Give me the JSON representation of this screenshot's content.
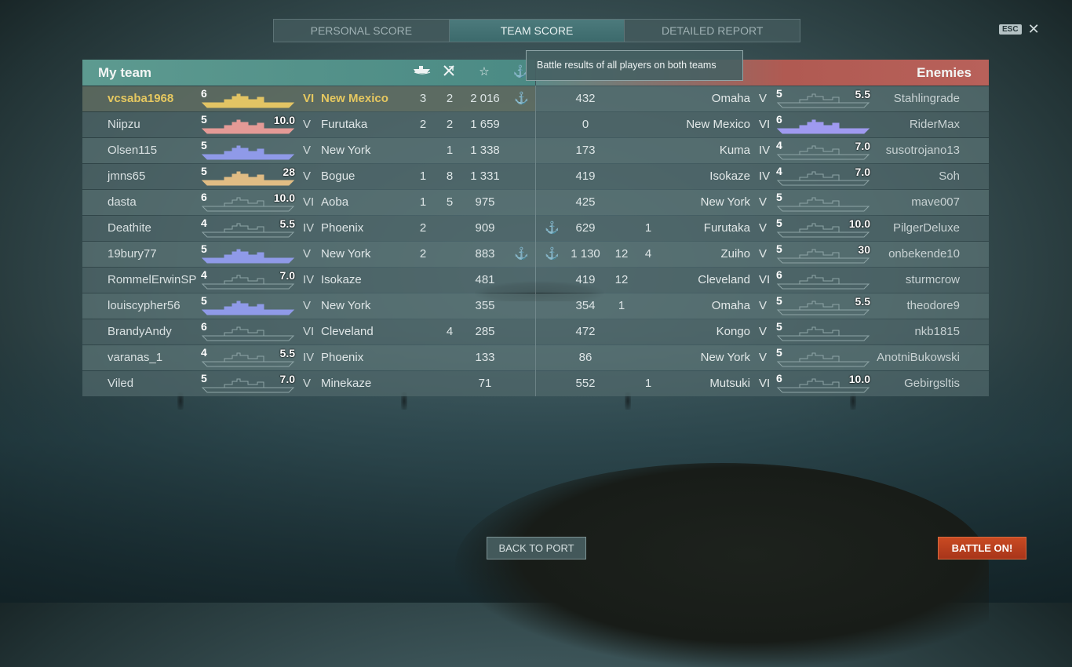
{
  "tabs": [
    {
      "label": "PERSONAL SCORE",
      "active": false
    },
    {
      "label": "TEAM SCORE",
      "active": true
    },
    {
      "label": "DETAILED REPORT",
      "active": false
    }
  ],
  "esc": {
    "key": "ESC",
    "close": "✕"
  },
  "header": {
    "my_team": "My team",
    "enemies": "Enemies",
    "icons": [
      "ship-sunk-icon",
      "planes-destroyed-icon",
      "star-icon",
      "anchor-icon"
    ]
  },
  "tooltip": "Battle results of all players on both teams",
  "colors": {
    "own_player": "#e6c860",
    "battle_button": "#c94a22"
  },
  "my_team": [
    {
      "name": "vcsaba1968",
      "level": "6",
      "power": "",
      "ship_color": "#e2c464",
      "tier": "VI",
      "ship": "New Mexico",
      "k1": "3",
      "k2": "2",
      "score": "2 016",
      "anchor": "⚓",
      "me": true
    },
    {
      "name": "Niipzu",
      "level": "5",
      "power": "10.0",
      "ship_color": "#e49a96",
      "tier": "V",
      "ship": "Furutaka",
      "k1": "2",
      "k2": "2",
      "score": "1 659",
      "anchor": ""
    },
    {
      "name": "Olsen115",
      "level": "5",
      "power": "",
      "ship_color": "#8f9ae8",
      "tier": "V",
      "ship": "New York",
      "k1": "",
      "k2": "1",
      "score": "1 338",
      "anchor": ""
    },
    {
      "name": "jmns65",
      "level": "5",
      "power": "28",
      "ship_color": "#e0bc84",
      "tier": "V",
      "ship": "Bogue",
      "k1": "1",
      "k2": "8",
      "score": "1 331",
      "anchor": ""
    },
    {
      "name": "dasta",
      "level": "6",
      "power": "10.0",
      "ship_color": "",
      "tier": "VI",
      "ship": "Aoba",
      "k1": "1",
      "k2": "5",
      "score": "975",
      "anchor": ""
    },
    {
      "name": "Deathite",
      "level": "4",
      "power": "5.5",
      "ship_color": "",
      "tier": "IV",
      "ship": "Phoenix",
      "k1": "2",
      "k2": "",
      "score": "909",
      "anchor": ""
    },
    {
      "name": "19bury77",
      "level": "5",
      "power": "",
      "ship_color": "#8f9ae8",
      "tier": "V",
      "ship": "New York",
      "k1": "2",
      "k2": "",
      "score": "883",
      "anchor": "⚓"
    },
    {
      "name": "RommelErwinSP",
      "level": "4",
      "power": "7.0",
      "ship_color": "",
      "tier": "IV",
      "ship": "Isokaze",
      "k1": "",
      "k2": "",
      "score": "481",
      "anchor": ""
    },
    {
      "name": "louiscypher56",
      "level": "5",
      "power": "",
      "ship_color": "#8f9ae8",
      "tier": "V",
      "ship": "New York",
      "k1": "",
      "k2": "",
      "score": "355",
      "anchor": ""
    },
    {
      "name": "BrandyAndy",
      "level": "6",
      "power": "",
      "ship_color": "",
      "tier": "VI",
      "ship": "Cleveland",
      "k1": "",
      "k2": "4",
      "score": "285",
      "anchor": ""
    },
    {
      "name": "varanas_1",
      "level": "4",
      "power": "5.5",
      "ship_color": "",
      "tier": "IV",
      "ship": "Phoenix",
      "k1": "",
      "k2": "",
      "score": "133",
      "anchor": ""
    },
    {
      "name": "Viled",
      "level": "5",
      "power": "7.0",
      "ship_color": "",
      "tier": "V",
      "ship": "Minekaze",
      "k1": "",
      "k2": "",
      "score": "71",
      "anchor": ""
    }
  ],
  "enemies": [
    {
      "anchor": "",
      "score": "432",
      "k2": "",
      "k1": "",
      "ship": "Omaha",
      "tier": "V",
      "level": "5",
      "power": "5.5",
      "ship_color": "",
      "name": "Stahlingrade"
    },
    {
      "anchor": "",
      "score": "0",
      "k2": "",
      "k1": "",
      "ship": "New Mexico",
      "tier": "VI",
      "level": "6",
      "power": "",
      "ship_color": "#9f9af0",
      "name": "RiderMax"
    },
    {
      "anchor": "",
      "score": "173",
      "k2": "",
      "k1": "",
      "ship": "Kuma",
      "tier": "IV",
      "level": "4",
      "power": "7.0",
      "ship_color": "",
      "name": "susotrojano13"
    },
    {
      "anchor": "",
      "score": "419",
      "k2": "",
      "k1": "",
      "ship": "Isokaze",
      "tier": "IV",
      "level": "4",
      "power": "7.0",
      "ship_color": "",
      "name": "Soh"
    },
    {
      "anchor": "",
      "score": "425",
      "k2": "",
      "k1": "",
      "ship": "New York",
      "tier": "V",
      "level": "5",
      "power": "",
      "ship_color": "",
      "name": "mave007"
    },
    {
      "anchor": "⚓",
      "score": "629",
      "k2": "",
      "k1": "1",
      "ship": "Furutaka",
      "tier": "V",
      "level": "5",
      "power": "10.0",
      "ship_color": "",
      "name": "PilgerDeluxe"
    },
    {
      "anchor": "⚓",
      "score": "1 130",
      "k2": "12",
      "k1": "4",
      "ship": "Zuiho",
      "tier": "V",
      "level": "5",
      "power": "30",
      "ship_color": "",
      "name": "onbekende10"
    },
    {
      "anchor": "",
      "score": "419",
      "k2": "12",
      "k1": "",
      "ship": "Cleveland",
      "tier": "VI",
      "level": "6",
      "power": "",
      "ship_color": "",
      "name": "sturmcrow"
    },
    {
      "anchor": "",
      "score": "354",
      "k2": "1",
      "k1": "",
      "ship": "Omaha",
      "tier": "V",
      "level": "5",
      "power": "5.5",
      "ship_color": "",
      "name": "theodore9"
    },
    {
      "anchor": "",
      "score": "472",
      "k2": "",
      "k1": "",
      "ship": "Kongo",
      "tier": "V",
      "level": "5",
      "power": "",
      "ship_color": "",
      "name": "nkb1815"
    },
    {
      "anchor": "",
      "score": "86",
      "k2": "",
      "k1": "",
      "ship": "New York",
      "tier": "V",
      "level": "5",
      "power": "",
      "ship_color": "",
      "name": "AnotniBukowski"
    },
    {
      "anchor": "",
      "score": "552",
      "k2": "",
      "k1": "1",
      "ship": "Mutsuki",
      "tier": "VI",
      "level": "6",
      "power": "10.0",
      "ship_color": "",
      "name": "Gebirgsltis"
    }
  ],
  "buttons": {
    "back": "BACK TO PORT",
    "battle": "BATTLE ON!"
  }
}
